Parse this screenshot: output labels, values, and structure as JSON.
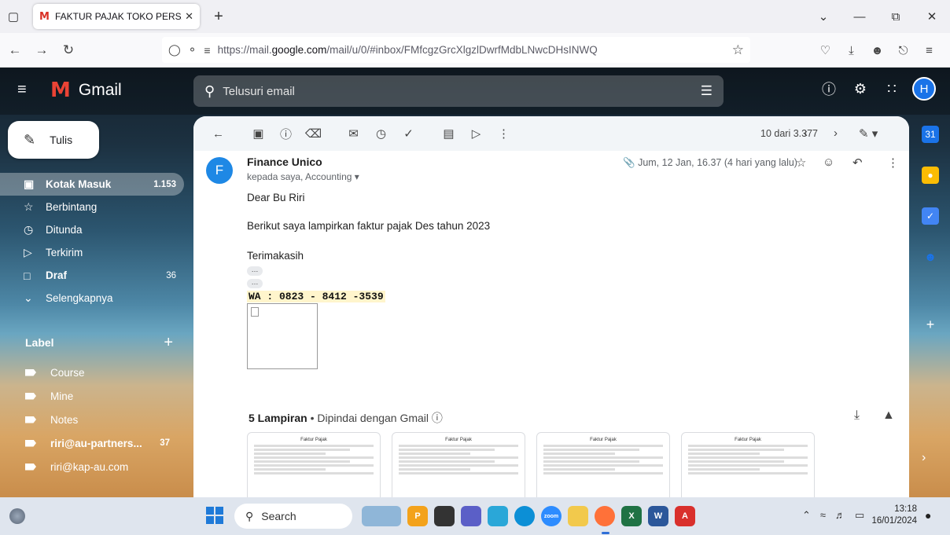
{
  "browser": {
    "tab_title": "FAKTUR PAJAK TOKO PERSADA",
    "url_prefix": "https://mail.",
    "url_domain": "google.com",
    "url_rest": "/mail/u/0/#inbox/FMfcgzGrcXlgzlDwrfMdbLNwcDHsINWQ"
  },
  "gmail": {
    "app_name": "Gmail",
    "search_placeholder": "Telusuri email",
    "avatar_letter": "H",
    "compose_label": "Tulis",
    "nav": [
      {
        "label": "Kotak Masuk",
        "count": "1.153"
      },
      {
        "label": "Berbintang",
        "count": ""
      },
      {
        "label": "Ditunda",
        "count": ""
      },
      {
        "label": "Terkirim",
        "count": ""
      },
      {
        "label": "Draf",
        "count": "36"
      },
      {
        "label": "Selengkapnya",
        "count": ""
      }
    ],
    "labels_title": "Label",
    "labels": [
      {
        "label": "Course",
        "count": ""
      },
      {
        "label": "Mine",
        "count": ""
      },
      {
        "label": "Notes",
        "count": ""
      },
      {
        "label": "riri@au-partners...",
        "count": "37"
      },
      {
        "label": "riri@kap-au.com",
        "count": ""
      }
    ]
  },
  "message": {
    "pager": "10 dari 3.377",
    "sender_initial": "F",
    "sender": "Finance Unico",
    "recipients": "kepada saya, Accounting",
    "date": "Jum, 12 Jan, 16.37 (4 hari yang lalu)",
    "greeting": "Dear Bu Riri",
    "line1": "Berikut saya lampirkan faktur pajak Des  tahun 2023",
    "closing": "Terimakasih",
    "wa": "WA : 0823 - 8412 -3539",
    "attachments_title": "5 Lampiran",
    "attachments_sub": "Dipindai dengan Gmail",
    "attachment_doc_title": "Faktur Pajak"
  },
  "taskbar": {
    "search": "Search",
    "time": "13:18",
    "date": "16/01/2024"
  }
}
